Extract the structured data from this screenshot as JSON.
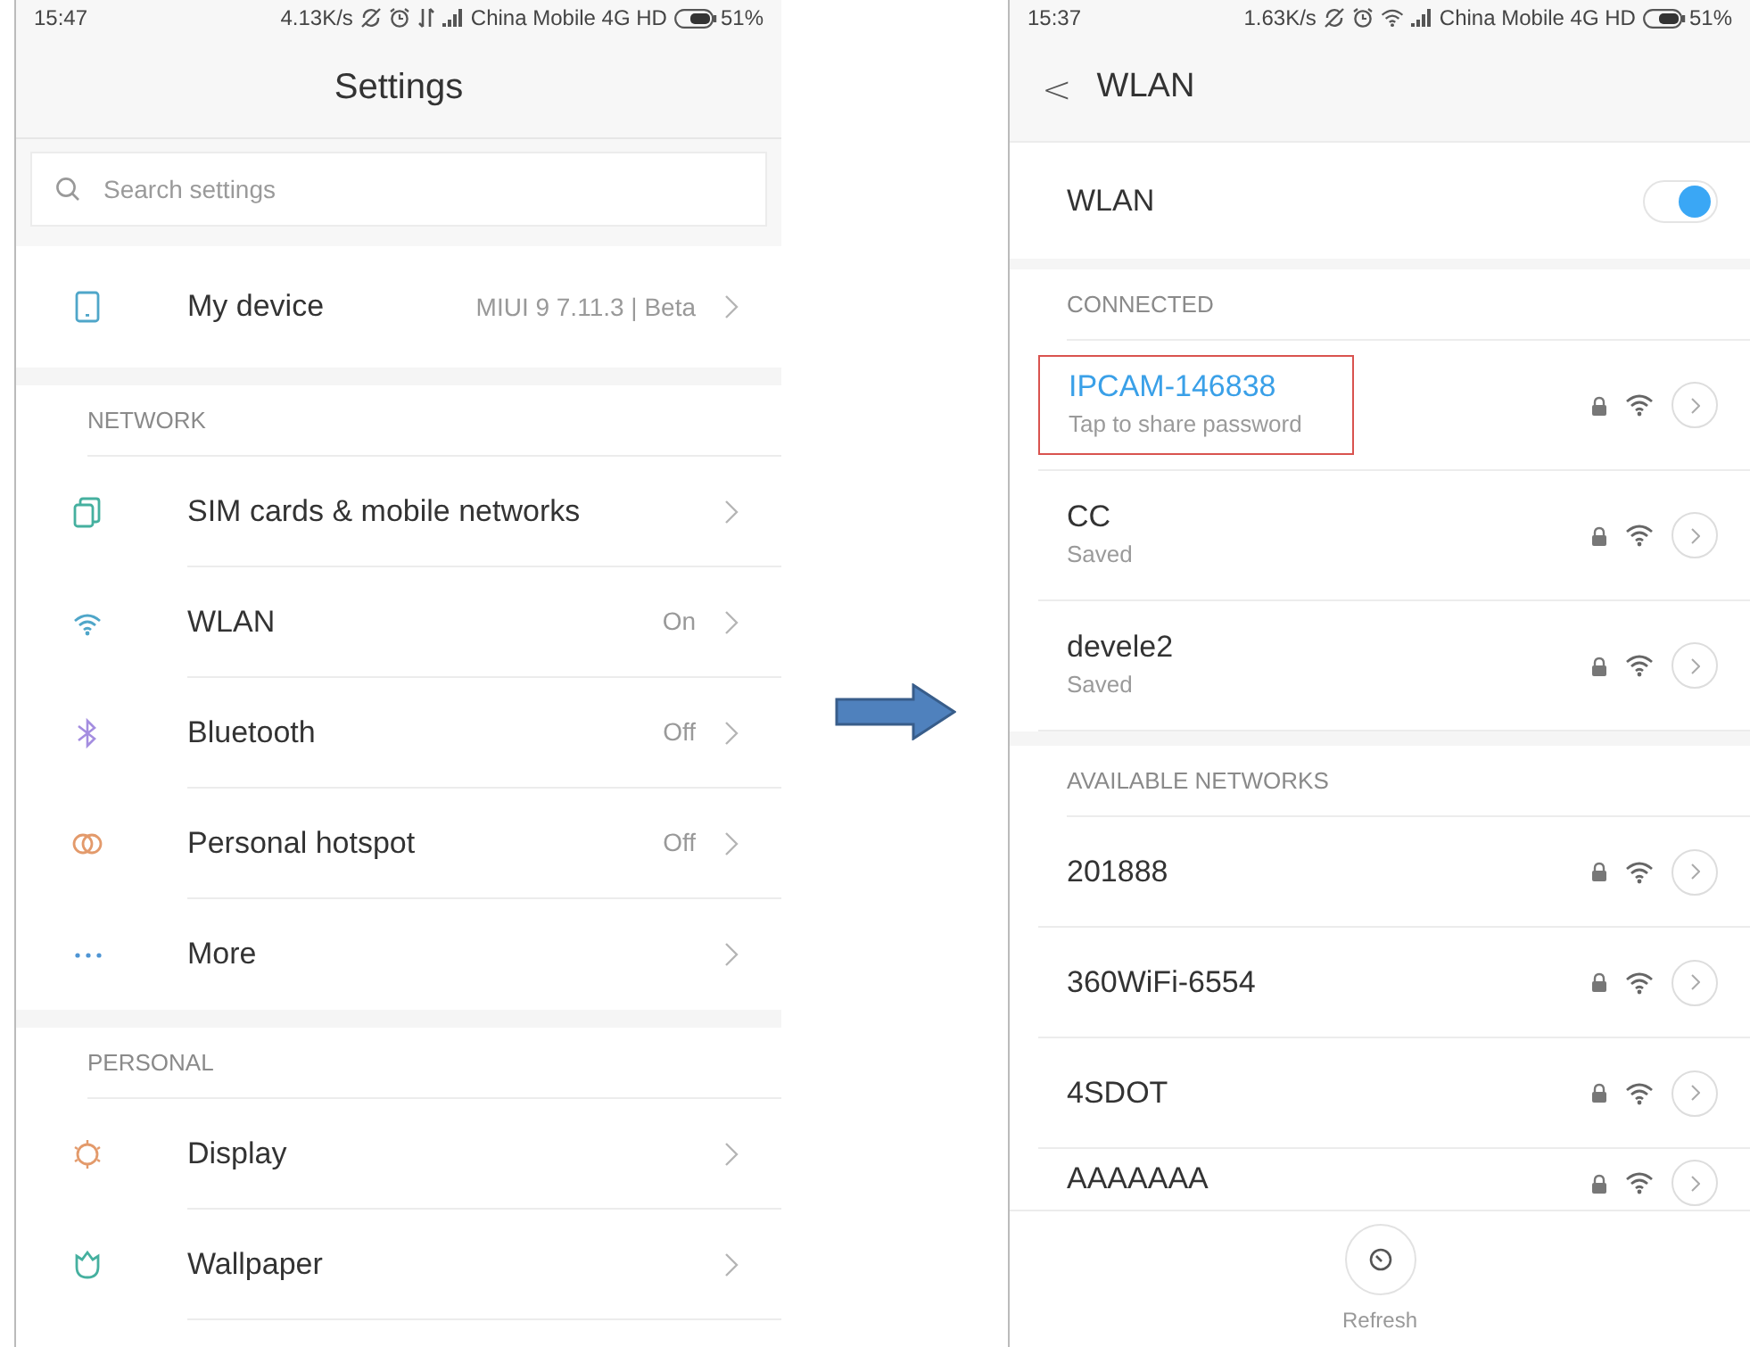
{
  "left_screen": {
    "status_bar": {
      "time": "15:47",
      "speed": "4.13K/s",
      "carrier": "China Mobile 4G HD",
      "battery": "51%"
    },
    "title": "Settings",
    "search": {
      "placeholder": "Search settings"
    },
    "sections": [
      {
        "items": [
          {
            "label": "My device",
            "value": "MIUI 9 7.11.3 | Beta"
          }
        ]
      },
      {
        "header": "NETWORK",
        "items": [
          {
            "label": "SIM cards & mobile networks"
          },
          {
            "label": "WLAN",
            "value": "On"
          },
          {
            "label": "Bluetooth",
            "value": "Off"
          },
          {
            "label": "Personal hotspot",
            "value": "Off"
          },
          {
            "label": "More"
          }
        ]
      },
      {
        "header": "PERSONAL",
        "items": [
          {
            "label": "Display"
          },
          {
            "label": "Wallpaper"
          }
        ]
      }
    ]
  },
  "right_screen": {
    "status_bar": {
      "time": "15:37",
      "speed": "1.63K/s",
      "carrier": "China Mobile 4G HD",
      "battery": "51%"
    },
    "back": "<",
    "title": "WLAN",
    "wlan_toggle": {
      "label": "WLAN",
      "on": true
    },
    "sections": [
      {
        "header": "CONNECTED",
        "networks": [
          {
            "name": "IPCAM-146838",
            "status": "Tap to share password",
            "connected": true,
            "highlighted": true
          },
          {
            "name": "CC",
            "status": "Saved",
            "connected": false,
            "highlighted": false
          },
          {
            "name": "devele2",
            "status": "Saved",
            "connected": false,
            "highlighted": false
          }
        ]
      },
      {
        "header": "AVAILABLE NETWORKS",
        "networks": [
          {
            "name": "201888",
            "connected": false,
            "highlighted": false
          },
          {
            "name": "360WiFi-6554",
            "connected": false,
            "highlighted": false
          },
          {
            "name": "4SDOT",
            "connected": false,
            "highlighted": false
          },
          {
            "name": "AAAAAAA",
            "connected": false,
            "highlighted": false
          }
        ]
      }
    ],
    "refresh_button": {
      "label": "Refresh"
    }
  }
}
